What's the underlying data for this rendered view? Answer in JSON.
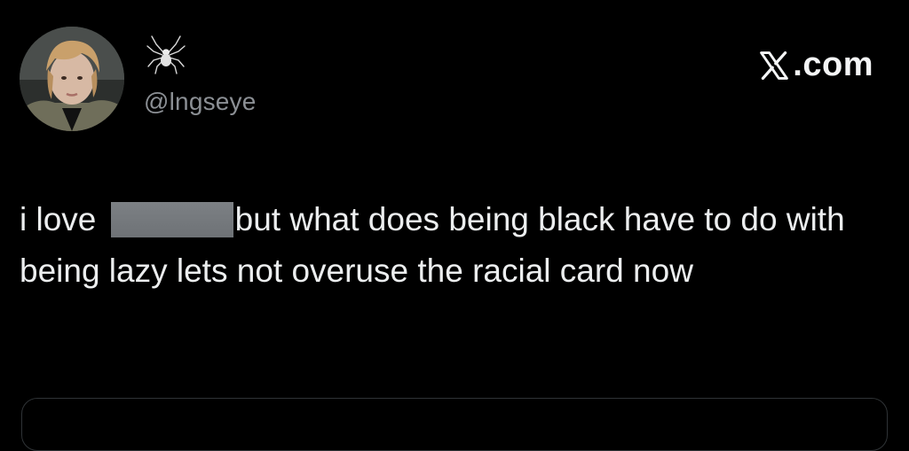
{
  "header": {
    "display_name_icon": "spider-icon",
    "handle": "@lngseye",
    "site_label": ".com",
    "site_icon": "x-logo-icon"
  },
  "avatar": {
    "icon": "profile-photo"
  },
  "tweet": {
    "text_before": "i love ",
    "redacted": true,
    "text_after": "but what does being black have to do with being lazy lets not overuse the racial card now"
  },
  "colors": {
    "background": "#000000",
    "text": "#e7e9ea",
    "handle": "#8b8f94",
    "redaction": "#75797d",
    "card_border": "#2f3336"
  }
}
